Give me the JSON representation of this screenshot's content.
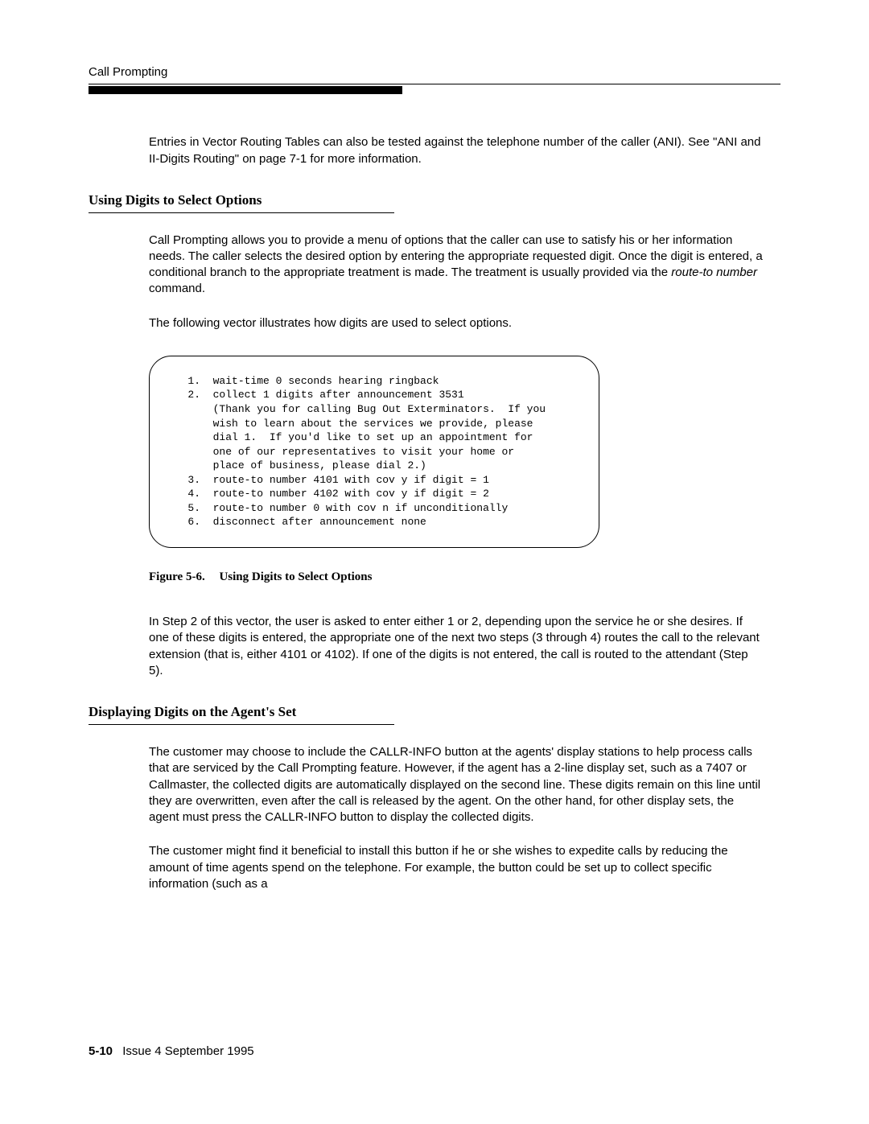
{
  "header": {
    "running_title": "Call Prompting"
  },
  "intro": {
    "para": "Entries in Vector Routing Tables can also be tested against the telephone number of the caller (ANI). See \"ANI and II-Digits Routing\" on page 7-1 for more information."
  },
  "section1": {
    "title": "Using Digits to Select Options",
    "para1a": "Call Prompting allows you to provide a menu of options that the caller can use to satisfy his or her information needs.  The caller selects the desired option by entering the appropriate requested digit. Once the digit is entered, a conditional branch to the appropriate treatment is made.  The treatment is usually provided via the ",
    "para1_ital": "route-to number",
    "para1b": " command.",
    "para2": "The following vector illustrates how digits are used to select options."
  },
  "figure": {
    "steps": [
      {
        "n": "1.",
        "text": "wait-time 0 seconds hearing ringback"
      },
      {
        "n": "2.",
        "text": "collect 1 digits after announcement 3531"
      },
      {
        "n": "",
        "text": "(Thank you for calling Bug Out Exterminators.  If you"
      },
      {
        "n": "",
        "text": "wish to learn about the services we provide, please"
      },
      {
        "n": "",
        "text": "dial 1.  If you'd like to set up an appointment for"
      },
      {
        "n": "",
        "text": "one of our representatives to visit your home or"
      },
      {
        "n": "",
        "text": "place of business, please dial 2.)"
      },
      {
        "n": "3.",
        "text": "route-to number 4101 with cov y if digit = 1"
      },
      {
        "n": "4.",
        "text": "route-to number 4102 with cov y if digit = 2"
      },
      {
        "n": "5.",
        "text": "route-to number 0 with cov n if unconditionally"
      },
      {
        "n": "6.",
        "text": "disconnect after announcement none"
      }
    ],
    "caption_label": "Figure 5-6.",
    "caption_title": "Using Digits to Select Options",
    "after": "In Step 2 of this vector, the user is asked to enter either 1 or 2, depending upon the service he or she desires.  If one of these digits is entered, the appropriate one of the next two steps (3 through 4) routes the call to the relevant extension (that is, either 4101 or 4102).  If one of the digits is not entered, the call is routed to the attendant (Step 5)."
  },
  "section2": {
    "title": "Displaying Digits on the Agent's Set",
    "para1": "The customer may choose to include the CALLR-INFO button  at the agents' display stations to help process calls that are serviced by the Call Prompting feature. However, if the agent has a 2-line display set, such as a 7407 or Callmaster, the collected digits are automatically displayed on the second line. These digits remain on this line until they are overwritten, even after the call is released by the agent.  On the other hand, for other display sets, the agent must press the CALLR-INFO button to display the collected digits.",
    "para2": "The customer might find it beneficial to install this button if he or she wishes to expedite calls by reducing the amount of time agents spend on the telephone. For example, the button could be set up to collect specific information (such as a"
  },
  "footer": {
    "page_number": "5-10",
    "issue": "Issue 4 September 1995"
  }
}
